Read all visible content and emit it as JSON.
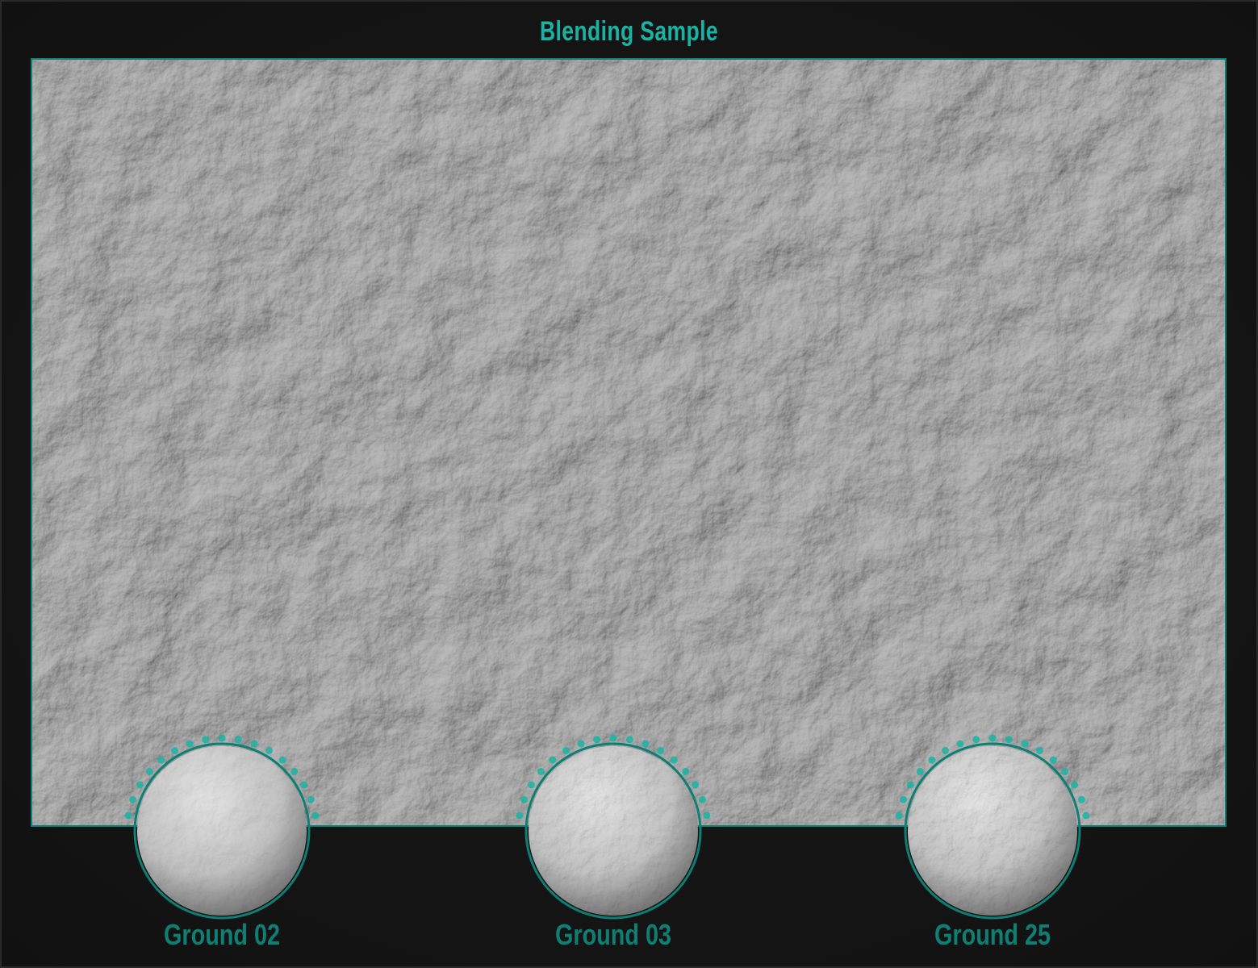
{
  "title": "Blending Sample",
  "colors": {
    "accent": "#1ab3a3",
    "border": "#0e7f74",
    "label": "#0f7f73"
  },
  "brushes": [
    {
      "label": "Ground 02"
    },
    {
      "label": "Ground 03"
    },
    {
      "label": "Ground 25"
    }
  ]
}
